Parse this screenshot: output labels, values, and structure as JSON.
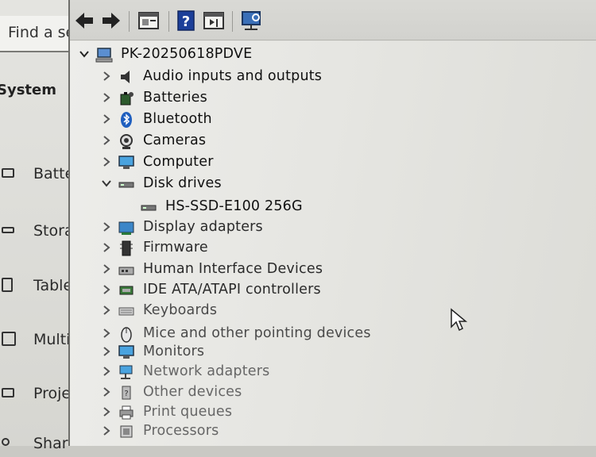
{
  "background_window": {
    "search_placeholder": "Find a se",
    "heading": "System",
    "items": [
      {
        "label": "Batte",
        "icon": "battery-icon"
      },
      {
        "label": "Stora",
        "icon": "storage-icon"
      },
      {
        "label": "Table",
        "icon": "tablet-icon"
      },
      {
        "label": "Multi",
        "icon": "multitasking-icon"
      },
      {
        "label": "Proje",
        "icon": "projecting-icon"
      },
      {
        "label": "Shar",
        "icon": "shared-icon"
      }
    ]
  },
  "device_manager": {
    "toolbar": {
      "buttons": [
        "back-icon",
        "forward-icon",
        "properties-icon",
        "help-icon",
        "view-icon",
        "scan-hardware-icon"
      ]
    },
    "computer_name": "PK-20250618PDVE",
    "categories": [
      {
        "label": "Audio inputs and outputs",
        "icon": "speaker-icon",
        "expanded": false
      },
      {
        "label": "Batteries",
        "icon": "battery-icon",
        "expanded": false
      },
      {
        "label": "Bluetooth",
        "icon": "bluetooth-icon",
        "expanded": false
      },
      {
        "label": "Cameras",
        "icon": "camera-icon",
        "expanded": false
      },
      {
        "label": "Computer",
        "icon": "monitor-icon",
        "expanded": false
      },
      {
        "label": "Disk drives",
        "icon": "disk-drive-icon",
        "expanded": true
      },
      {
        "label": "HS-SSD-E100 256G",
        "icon": "disk-drive-icon",
        "child": true
      },
      {
        "label": "Display adapters",
        "icon": "display-adapter-icon",
        "expanded": false
      },
      {
        "label": "Firmware",
        "icon": "firmware-icon",
        "expanded": false
      },
      {
        "label": "Human Interface Devices",
        "icon": "hid-icon",
        "expanded": false
      },
      {
        "label": "IDE ATA/ATAPI controllers",
        "icon": "ide-controller-icon",
        "expanded": false
      },
      {
        "label": "Keyboards",
        "icon": "keyboard-icon",
        "expanded": false
      },
      {
        "label": "Mice and other pointing devices",
        "icon": "mouse-icon",
        "expanded": false
      },
      {
        "label": "Monitors",
        "icon": "monitor-icon",
        "expanded": false
      },
      {
        "label": "Network adapters",
        "icon": "network-adapter-icon",
        "expanded": false
      },
      {
        "label": "Other devices",
        "icon": "other-devices-icon",
        "expanded": false
      },
      {
        "label": "Print queues",
        "icon": "printer-icon",
        "expanded": false
      },
      {
        "label": "Processors",
        "icon": "processor-icon",
        "expanded": false
      }
    ]
  }
}
